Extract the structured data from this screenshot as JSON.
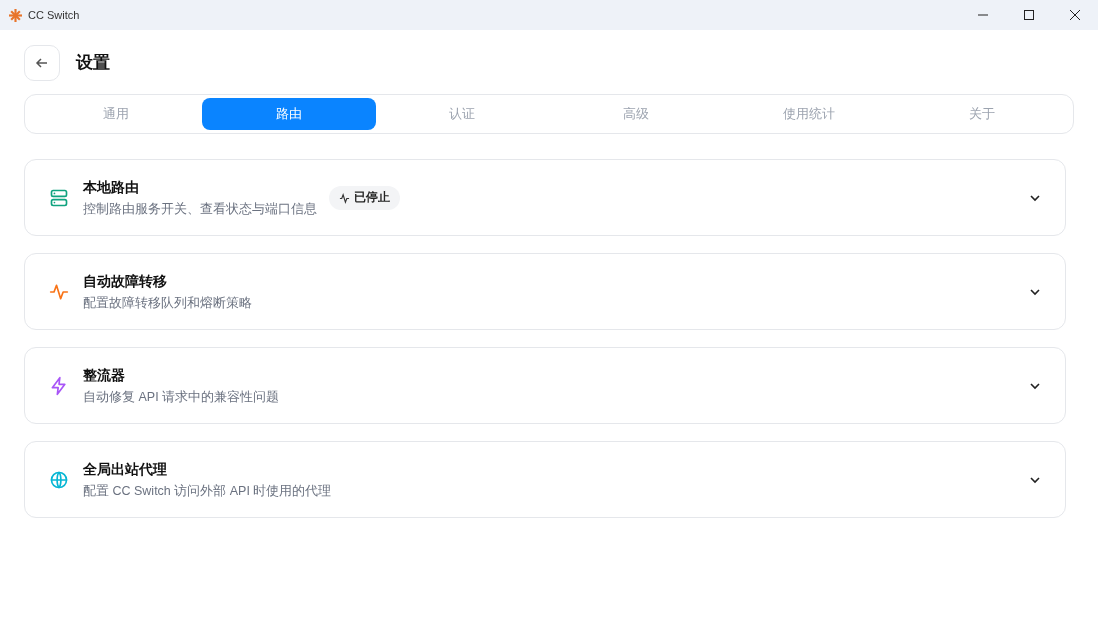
{
  "window": {
    "title": "CC Switch"
  },
  "header": {
    "title": "设置"
  },
  "tabs": [
    {
      "label": "通用",
      "selected": false
    },
    {
      "label": "路由",
      "selected": true
    },
    {
      "label": "认证",
      "selected": false
    },
    {
      "label": "高级",
      "selected": false
    },
    {
      "label": "使用统计",
      "selected": false
    },
    {
      "label": "关于",
      "selected": false
    }
  ],
  "sections": [
    {
      "kind": "server",
      "color": "#10a37f",
      "title": "本地路由",
      "description": "控制路由服务开关、查看状态与端口信息",
      "badge": "已停止",
      "expanded": false
    },
    {
      "kind": "activity",
      "color": "#f97316",
      "title": "自动故障转移",
      "description": "配置故障转移队列和熔断策略",
      "expanded": false
    },
    {
      "kind": "zap",
      "color": "#a855f7",
      "title": "整流器",
      "description": "自动修复 API 请求中的兼容性问题",
      "expanded": false
    },
    {
      "kind": "globe",
      "color": "#06b6d4",
      "title": "全局出站代理",
      "description": "配置 CC Switch 访问外部 API 时使用的代理",
      "expanded": false
    }
  ]
}
